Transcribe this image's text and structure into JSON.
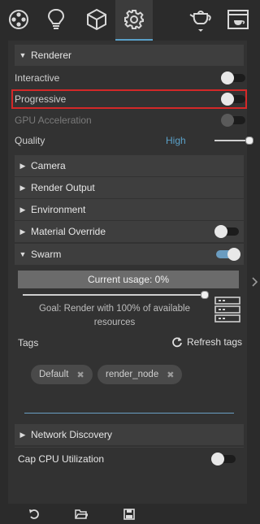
{
  "tabs": [
    {
      "icon": "scene-tree-icon"
    },
    {
      "icon": "lightbulb-icon"
    },
    {
      "icon": "cube-icon"
    },
    {
      "icon": "gear-icon",
      "active": true
    },
    {
      "icon": "teapot-icon"
    },
    {
      "icon": "render-window-icon"
    }
  ],
  "renderer": {
    "title": "Renderer",
    "interactive": {
      "label": "Interactive",
      "on": false
    },
    "progressive": {
      "label": "Progressive",
      "on": false
    },
    "gpu": {
      "label": "GPU Acceleration",
      "on": false,
      "disabled": true
    },
    "quality": {
      "label": "Quality",
      "value": "High"
    }
  },
  "sections": {
    "camera": "Camera",
    "render_output": "Render Output",
    "environment": "Environment",
    "material_override": "Material Override",
    "swarm": "Swarm",
    "network_discovery": "Network Discovery"
  },
  "swarm": {
    "usage": "Current usage: 0%",
    "slider_fraction": 1.0,
    "goal": "Goal: Render with 100% of available resources"
  },
  "tags": {
    "label": "Tags",
    "refresh": "Refresh tags",
    "chips": [
      "Default",
      "render_node"
    ]
  },
  "cap_cpu": {
    "label": "Cap CPU Utilization",
    "on": false
  },
  "colors": {
    "accent": "#5aa0c8",
    "highlight": "#d42828",
    "toggle_on": "#6a9cc0"
  }
}
